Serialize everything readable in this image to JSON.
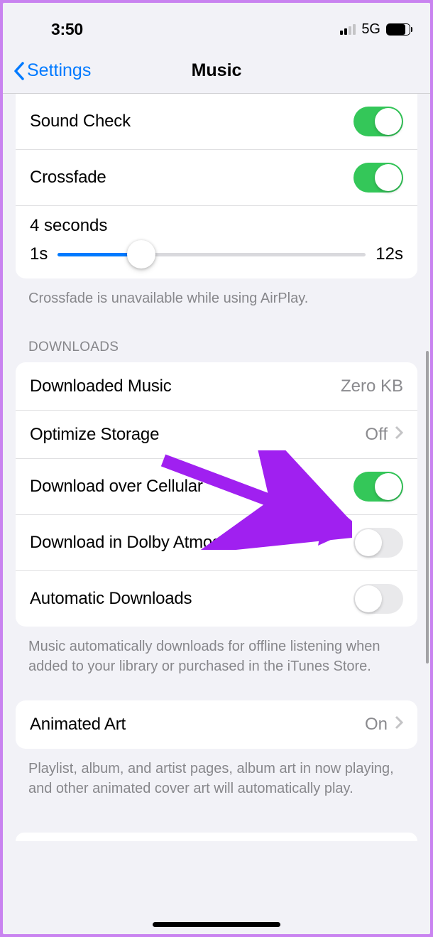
{
  "status": {
    "time": "3:50",
    "network": "5G"
  },
  "nav": {
    "back_label": "Settings",
    "title": "Music"
  },
  "playback": {
    "sound_check": {
      "label": "Sound Check",
      "on": true
    },
    "crossfade": {
      "label": "Crossfade",
      "on": true
    },
    "slider": {
      "title": "4 seconds",
      "min_label": "1s",
      "max_label": "12s",
      "value_pct": 27
    }
  },
  "playback_footer": "Crossfade is unavailable while using AirPlay.",
  "downloads_header": "DOWNLOADS",
  "downloads": {
    "downloaded_music": {
      "label": "Downloaded Music",
      "value": "Zero KB"
    },
    "optimize_storage": {
      "label": "Optimize Storage",
      "value": "Off"
    },
    "download_cellular": {
      "label": "Download over Cellular",
      "on": true
    },
    "download_dolby": {
      "label": "Download in Dolby Atmos",
      "on": false
    },
    "automatic": {
      "label": "Automatic Downloads",
      "on": false
    }
  },
  "downloads_footer": "Music automatically downloads for offline listening when added to your library or purchased in the iTunes Store.",
  "animated_art": {
    "label": "Animated Art",
    "value": "On"
  },
  "animated_footer": "Playlist, album, and artist pages, album art in now playing, and other animated cover art will automatically play."
}
